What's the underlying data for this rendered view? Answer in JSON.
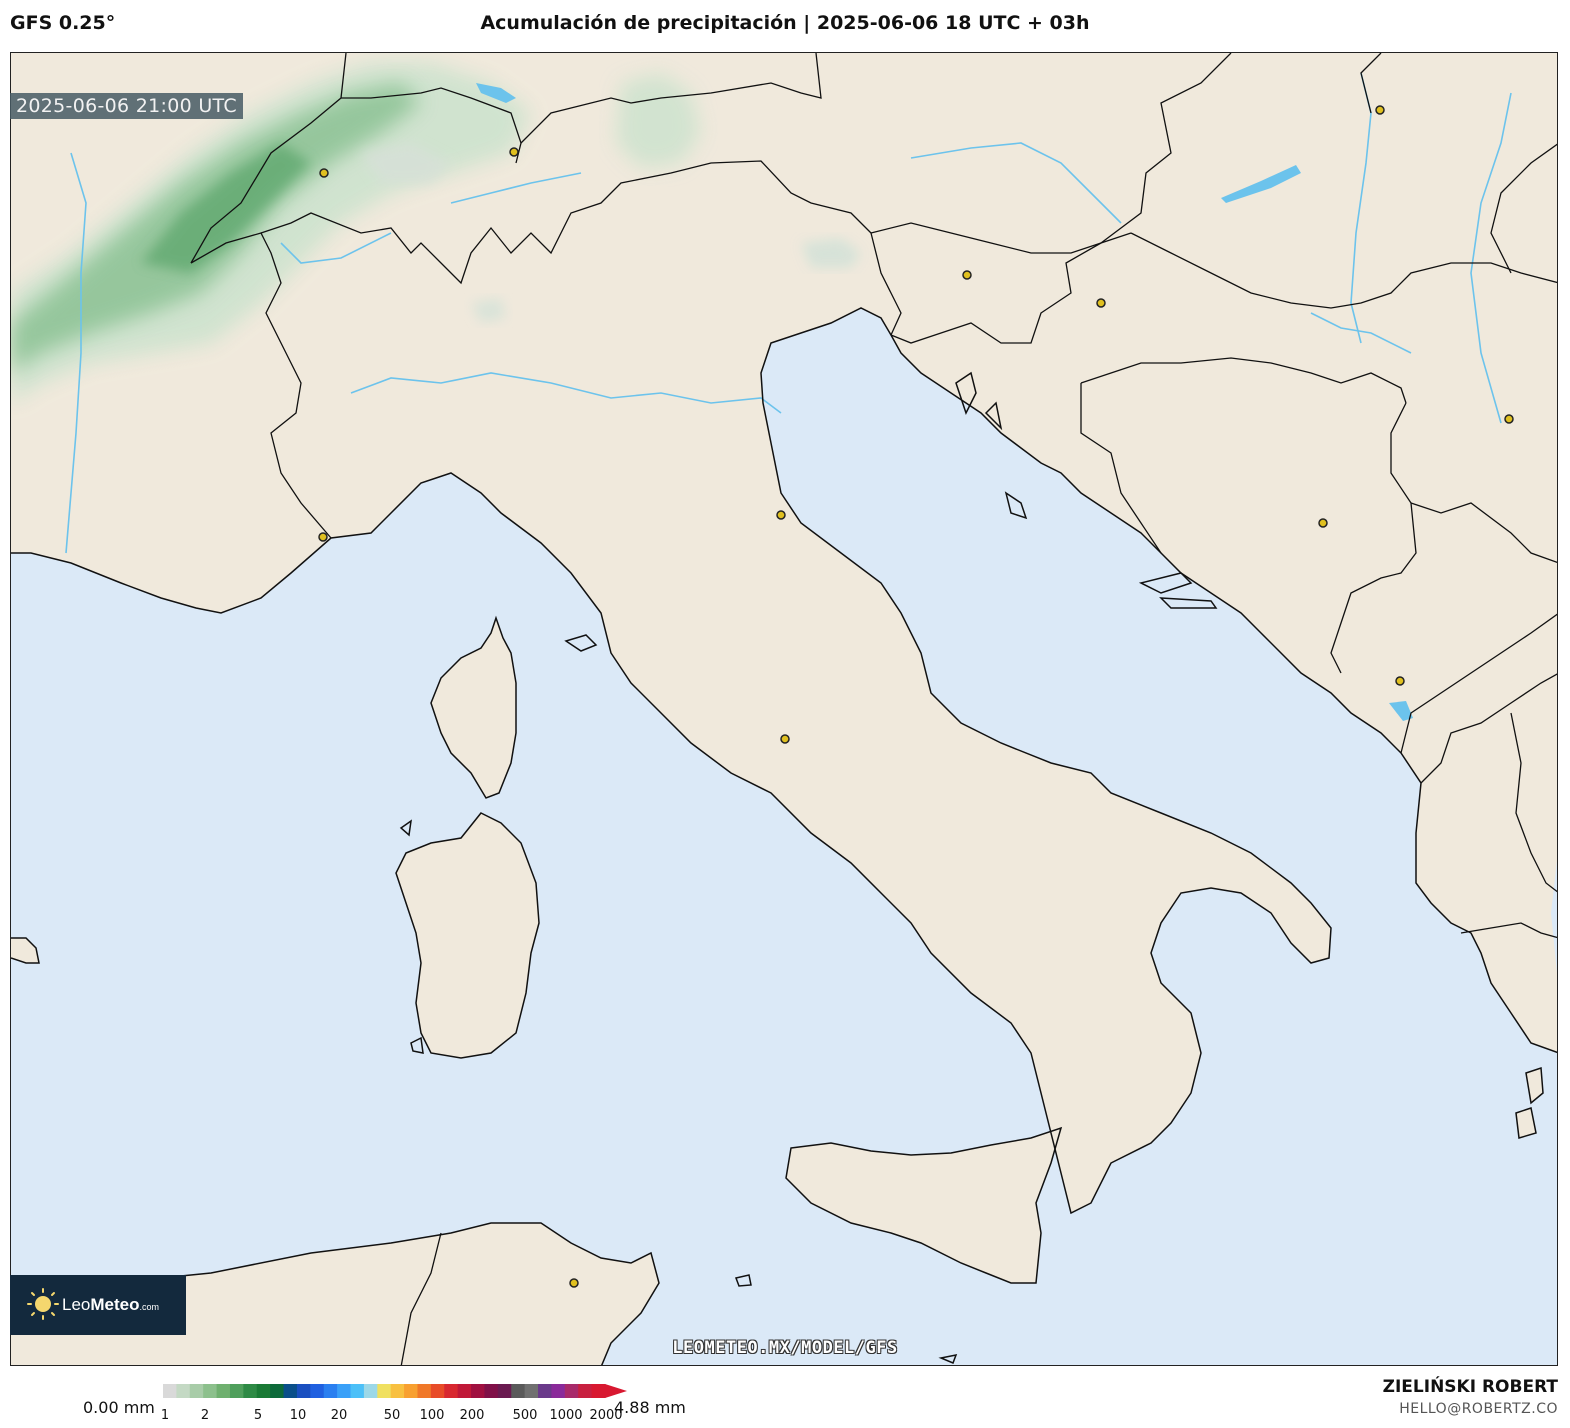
{
  "header": {
    "model": "GFS 0.25°",
    "title": "Acumulación de precipitación | 2025-06-06 18 UTC + 03h"
  },
  "map": {
    "valid_time": "2025-06-06 21:00 UTC",
    "colors": {
      "sea": "#dbe9f7",
      "land": "#f0e9dc",
      "coast": "#111111",
      "river": "#6cc3ec",
      "lake": "#6cc3ec",
      "precip_light": "#cfe3cf",
      "precip_mid": "#8cc294",
      "precip_heavy": "#5aa56a",
      "city_dot": "#e0c020"
    },
    "watermark": "LEOMETEO.MX/MODEL/GFS"
  },
  "logo": {
    "name_part1": "Leo",
    "name_part2": "Meteo",
    "suffix": ".com"
  },
  "colorbar": {
    "min_label": "0.00 mm",
    "max_label": "4.88 mm",
    "ticks": [
      "1",
      "2",
      "5",
      "10",
      "20",
      "50",
      "100",
      "200",
      "500",
      "1000",
      "2000"
    ],
    "colors": [
      "#d9d9d9",
      "#c4d9c4",
      "#a8cca8",
      "#8cc08c",
      "#6fb06f",
      "#4f9f5c",
      "#2e8a45",
      "#1a7a35",
      "#0d6a3a",
      "#0a4f8a",
      "#1a4fc0",
      "#2060e0",
      "#2a7ff0",
      "#3aa0f8",
      "#4cc0f8",
      "#9cd8e8",
      "#f0e060",
      "#f8c040",
      "#f8a030",
      "#f07828",
      "#e84c28",
      "#d82830",
      "#c01838",
      "#a01040",
      "#801048",
      "#6a1a50",
      "#5a5a5a",
      "#707070",
      "#6a3a8a",
      "#8a2a9a",
      "#a82a6a",
      "#c82040",
      "#d81830"
    ]
  },
  "footer": {
    "author": "ZIELIŃSKI ROBERT",
    "email": "HELLO@ROBERTZ.CO"
  }
}
